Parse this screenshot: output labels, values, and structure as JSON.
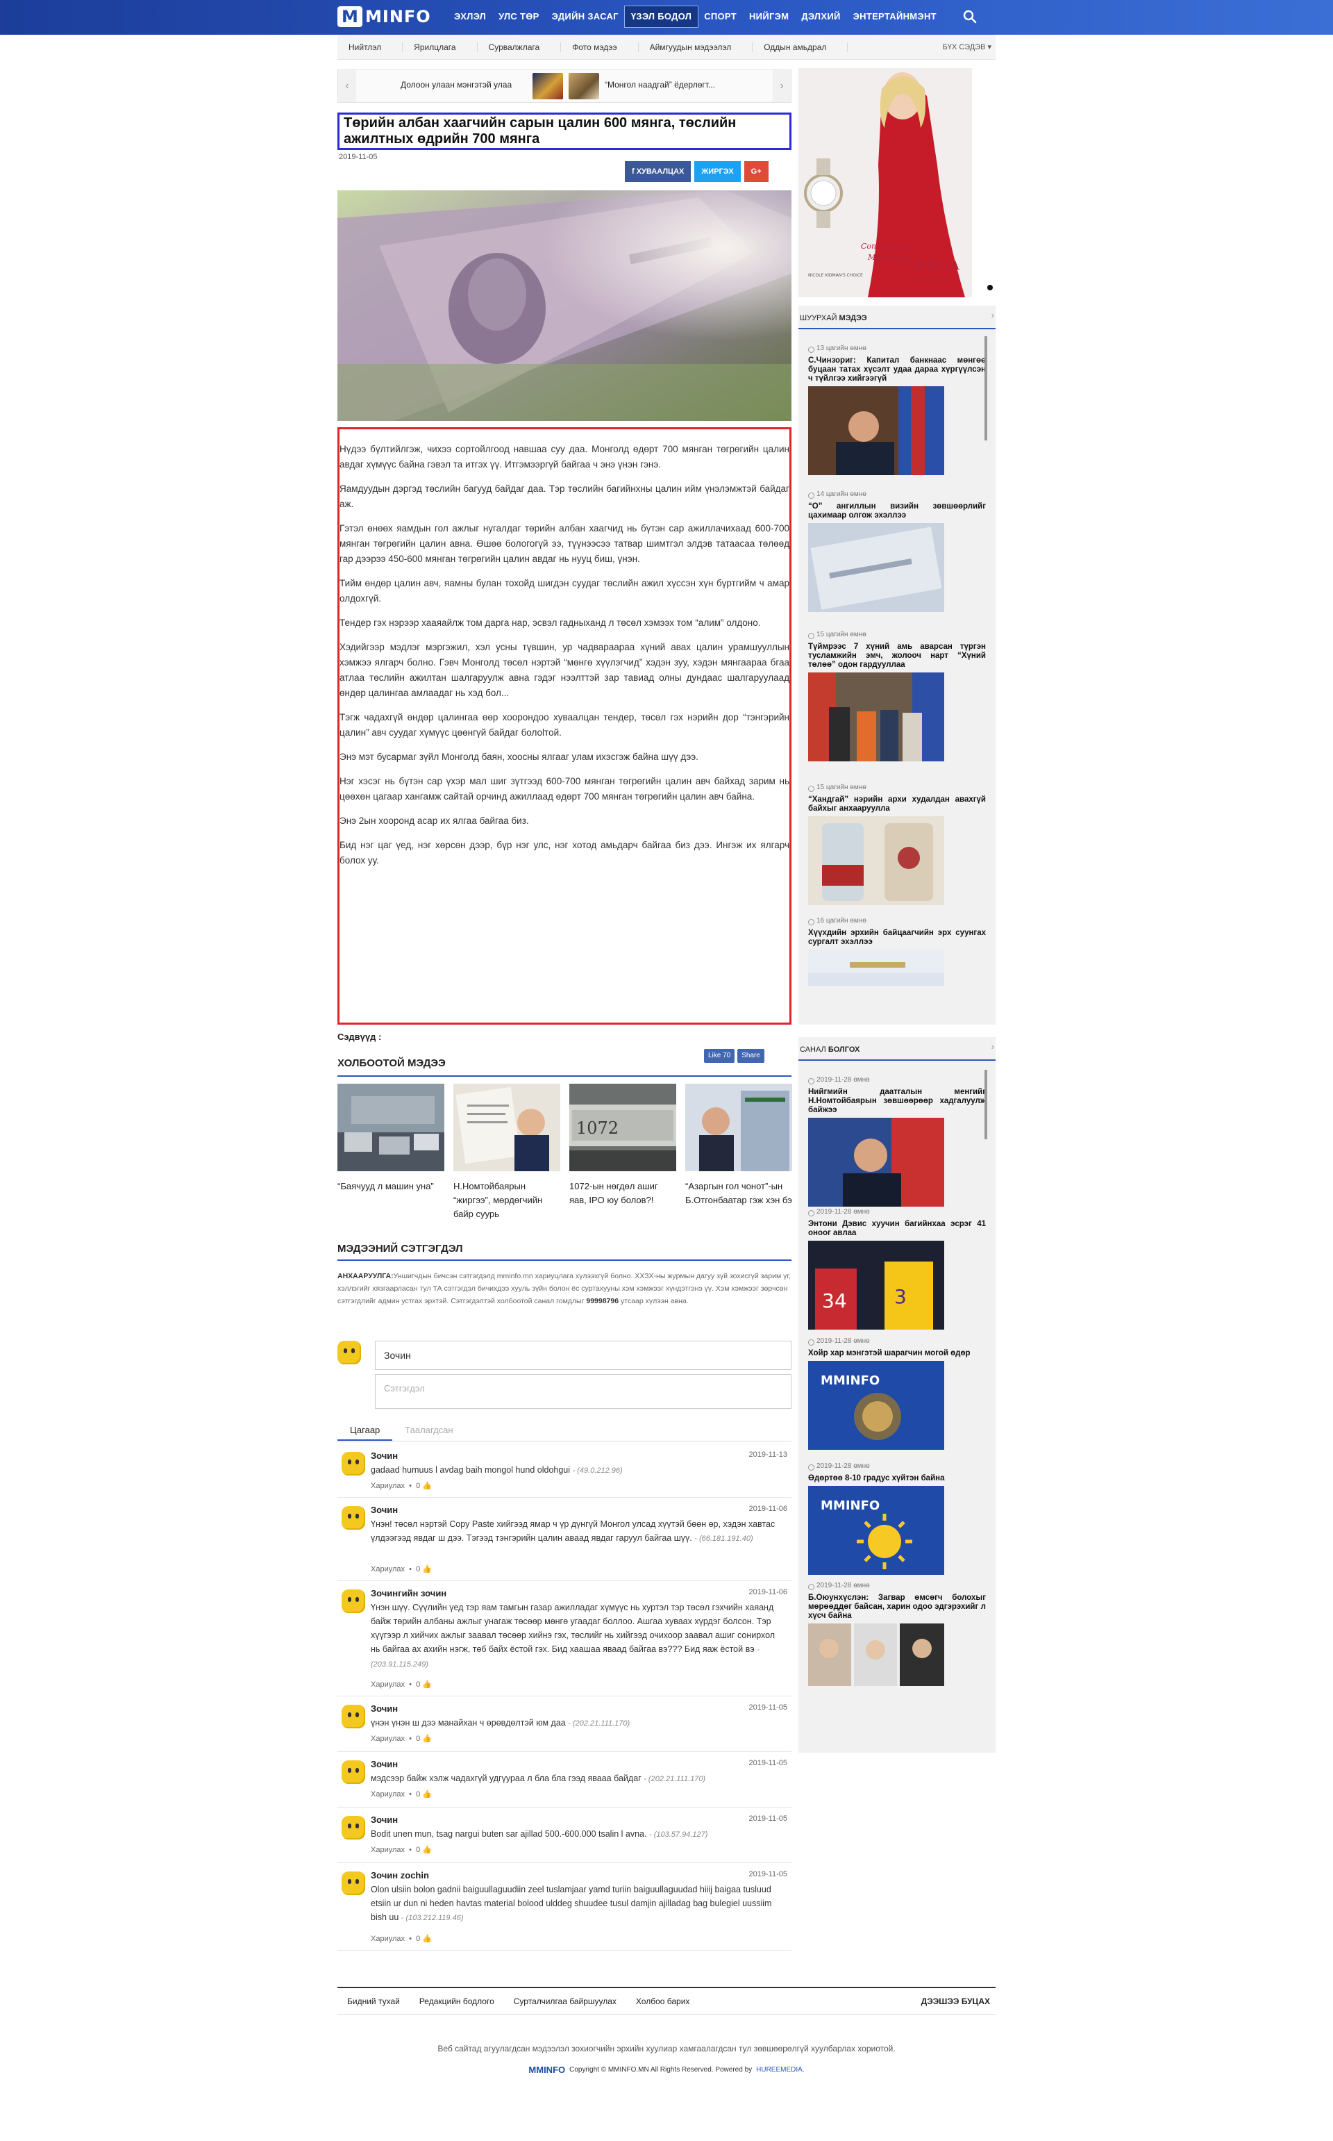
{
  "site": {
    "logo_mark": "M",
    "logo_text": "MINFO"
  },
  "nav": [
    {
      "label": "ЭХЛЭЛ"
    },
    {
      "label": "УЛС ТӨР"
    },
    {
      "label": "ЭДИЙН ЗАСАГ"
    },
    {
      "label": "ҮЗЭЛ БОДОЛ"
    },
    {
      "label": "СПОРТ"
    },
    {
      "label": "НИЙГЭМ"
    },
    {
      "label": "ДЭЛХИЙ"
    },
    {
      "label": "ЭНТЕРТАЙНМЭНТ"
    }
  ],
  "subnav": [
    {
      "label": "Нийтлэл"
    },
    {
      "label": "Ярилцлага"
    },
    {
      "label": "Сурвалжлага"
    },
    {
      "label": "Фото мэдээ"
    },
    {
      "label": "Аймгуудын мэдээлэл"
    },
    {
      "label": "Оддын амьдрал"
    }
  ],
  "subnav_all": "БҮХ СЭДЭВ ▾",
  "ticker": {
    "prev": "‹",
    "next": "›",
    "item1": "Долоон улаан мэнгэтэй улаан...",
    "item2": "“Монгол наадгай” ёдерлөгт..."
  },
  "article": {
    "title": "Төрийн албан хаагчийн сарын цалин 600 мянга, төслийн ажилтных өдрийн 700 мянга",
    "date": "2019-11-05",
    "paragraphs": [
      "Нүдээ бүлтийлгэж, чихээ сортойлгоод навшаа суу даа. Монголд өдөрт 700 мянган төгрөгийн цалин авдаг хүмүүс байна гэвэл та итгэх үү. Итгэмээргүй байгаа ч энэ үнэн гэнэ.",
      "Яамдуудын дэргэд төслийн багууд байдаг даа. Тэр төслийн багийнхны цалин ийм үнэлэмжтэй байдаг аж.",
      "Гэтэл өнөөх яамдын гол ажлыг нугалдаг төрийн албан хаагчид нь бүтэн сар ажиллачихаад 600-700 мянган төгрөгийн цалин авна. Өшөө бологогүй ээ, түүнээсээ татвар шимтгэл элдэв татаасаа төлөөд гар дээрээ 450-600 мянган төгрөгийн цалин авдаг нь нууц биш, үнэн.",
      "Тийм өндөр цалин авч, яамны булан тохойд шигдэн суудаг төслийн ажил хүссэн хүн бүртгийм ч амар олдохгүй.",
      "Тендер гэх нэрээр хааяайлж том дарга нар, эсвэл гадныханд л төсөл хэмээх том “алим” олдоно.",
      "Хэдийгээр мэдлэг мэргэжил, хэл усны түвшин, ур чадвараараа хүний авах цалин урамшууллын хэмжээ ялгарч болно. Гэвч Монголд төсөл нэртэй “мөнгө хүүлэгчид” хэдэн зуу, хэдэн мянгаараа бгаа атлаа төслийн ажилтан шалгаруулж авна гэдэг нээлттэй зар тавиад олны дундаас шалгаруулаад өндөр цалингаа амлаадаг нь хэд бол...",
      "Тэгж чадахгүй өндөр цалингаа өөр хоорондоо хуваалцан тендер, төсөл гэх нэрийн дор “тэнгэрийн цалин” авч суудаг хүмүүс цөөнгүй байдаг болоlтой.",
      "Энэ мэт бусармаг зүйл Монголд баян, хоосны ялгааг улам ихэсгэж байна шүү дээ.",
      "Нэг хэсэг нь бүтэн сар үхэр мал шиг зүтгээд 600-700 мянган төгрөгийн цалин авч байхад зарим нь цөөхөн цагаар хангамж сайтай орчинд ажиллаад өдөрт 700 мянган төгрөгийн цалин авч байна.",
      "Энэ 2ын хооронд асар их ялгаа байгаа биз.",
      "Бид нэг цаг үед, нэг хөрсөн дээр, бүр нэг улс, нэг хотод амьдарч байгаа биз дээ. Ингэж их ялгарч болох уу."
    ],
    "tags_label": "Сэдвүүд :"
  },
  "share": {
    "facebook": "f  ХУВААЛЦАХ",
    "twitter": "ЖИРГЭХ",
    "google": "G+"
  },
  "related": {
    "title": "ХОЛБООТОЙ МЭДЭЭ",
    "like": "Like 70",
    "share_btn": "Share",
    "items": [
      {
        "caption": "“Баячууд л машин уна”"
      },
      {
        "caption": "Н.Номтойбаярын “жиргээ”, мөрдөгчийн байр суурь"
      },
      {
        "caption": "1072-ын нөгдөл ашиг яав, IPO юу болов?!"
      },
      {
        "caption": "“Азаргын гол чонот”-ын Б.Отгонбаатар гэж хэн бэ"
      }
    ]
  },
  "comments_section": {
    "title": "МЭДЭЭНИЙ СЭТГЭГДЭЛ",
    "notice_label": "АНХААРУУЛГА:",
    "notice": "Уншигчдын бичсэн сэтгэгдэлд mminfo.mn хариуцлага хүлээхгүй болно. ХХЗХ-ны журмын дагуу зүй зохисгүй зарим үг, хэллэгийг хязгаарласан тул ТА сэтгэгдэл бичихдээ хууль зүйн болон ёс суртахууны хэм хэмжээг хүндэтгэнэ үү. Хэм хэмжээг зөрчсөн сэтгэгдлийг админ устгах эрхтэй. Сэтгэгдэлтэй холбоотой санал гомдлыг",
    "notice_phone": "99998796",
    "notice_tail": "утсаар хүлээн авна.",
    "name_value": "Зочин",
    "body_placeholder": "Сэтгэгдэл",
    "tab_time": "Цагаар",
    "tab_popular": "Таалагдсан",
    "reply_label": "Хариулах",
    "items": [
      {
        "author": "Зочин",
        "date": "2019-11-13",
        "text": "gadaad humuus l avdag baih mongol hund oldohgui",
        "ip": "- (49.0.212.96)",
        "likes": "0"
      },
      {
        "author": "Зочин",
        "date": "2019-11-06",
        "text": "Үнэн! төсөл нэртэй Copy Paste хийгээд ямар ч үр дүнгүй Монгол улсад хүүтэй бөөн өр, хэдэн хавтас үлдээгээд явдаг ш дээ. Тэгээд тэнгэрийн цалин аваад явдаг гаруул байгаа шүү.",
        "ip": "- (66.181.191.40)",
        "likes": "0"
      },
      {
        "author": "Зочингийн зочин",
        "date": "2019-11-06",
        "text": "Үнэн шүү. Сүүлийн үед тэр яам тамгын газар ажилладаг хүмүүс нь хуртэл тэр төсөл гэхчийн хаяанд байж төрийн албаны ажлыг унагаж төсөөр мөнгө угаадаг боллоо. Ашгаа хуваах хүрдэг болсон. Тэр хүүгээр л хийчих ажлыг заавал төсөөр хийнэ гэх, төслийг нь хийгээд очихоор заавал ашиг сонирхол нь байгаа ах ахийн нэгж, төб байх ёстой гэх. Бид хаашаа яваад байгаа вэ??? Бид яаж ёстой вэ",
        "ip": "- (203.91.115.249)",
        "likes": "0"
      },
      {
        "author": "Зочин",
        "date": "2019-11-05",
        "text": "үнэн үнэн ш дээ манайхан ч өрөвдөлтэй юм даа",
        "ip": "- (202.21.111.170)",
        "likes": "0"
      },
      {
        "author": "Зочин",
        "date": "2019-11-05",
        "text": "мэдсээр байж хэлж чадахгүй удгүураа л бла бла гээд явааа байдаг",
        "ip": "- (202.21.111.170)",
        "likes": "0"
      },
      {
        "author": "Зочин",
        "date": "2019-11-05",
        "text": "Bodit unen mun, tsag nargui buten sar ajillad 500.-600.000 tsalin l avna.",
        "ip": "- (103.57.94.127)",
        "likes": "0"
      },
      {
        "author": "Зочин zochin",
        "date": "2019-11-05",
        "text": "Olon ulsiin bolon gadnii baiguullaguudiin zeel tuslamjaar yamd turiin baiguullaguudad hiiij baigaa tusluud etsiin ur dun ni heden havtas material bolood ulddeg shuudee tusul damjin ajilladag bag bulegiel uussiim bish uu",
        "ip": "- (103.212.119.46)",
        "likes": "0"
      }
    ]
  },
  "sidebar": {
    "breaking_title_a": "ШУУРХАЙ ",
    "breaking_title_b": "МЭДЭЭ",
    "more": "›",
    "breaking": [
      {
        "time": "13 цагийн өмнө",
        "title": "С.Чинзориг: Капитал банкнаас мөнгөө буцаан татах хүсэлт удаа дараа хүргүүлсэн ч түйлгээ хийгээгүй"
      },
      {
        "time": "14 цагийн өмнө",
        "title": "“О” ангиллын визийн зөвшөөрлийг цахимаар олгож эхэллээ"
      },
      {
        "time": "15 цагийн өмнө",
        "title": "Түймрээс 7 хүний амь аварсан түргэн тусламжийн эмч, жолооч нарт “Хүний төлөө” одон гардууллаа"
      },
      {
        "time": "15 цагийн өмнө",
        "title": "“Хандгай” нэрийн архи худалдан авахгүй байхыг анхааруулла"
      },
      {
        "time": "16 цагийн өмнө",
        "title": "Хүүхдийн эрхийн байцаагчийн эрх суунгах сургалт эхэллээ"
      }
    ],
    "poll_title_a": "САНАЛ ",
    "poll_title_b": "БОЛГОХ",
    "opinion": [
      {
        "time": "2019-11-28 өмнө",
        "title": "Нийгмийн даатгалын менгийг Н.Номтойбаярын зөвшөөрөөр хадгалуулж байжээ"
      },
      {
        "time": "2019-11-28 өмнө",
        "title": "Энтони Дэвис хуучин багийнхаа эсрэг 41 оноог авлаа"
      },
      {
        "time": "2019-11-28 өмнө",
        "title": "Хойр хар мэнгэтэй шарагчин могой өдөр"
      },
      {
        "time": "2019-11-28 өмнө",
        "title": "Өдөртөө 8-10 градус хүйтэн байна"
      },
      {
        "time": "2019-11-28 өмнө",
        "title": "Б.Оюунхүслэн: Загвар өмсөгч болохыг мөрөөддөг байсан, харин одоо эдгэрэхийг л хүсч байна"
      }
    ],
    "ad_text1": "Constellation",
    "ad_text2": "Manhattan",
    "ad_brand": "OMEGA",
    "ad_cta": "DISCOVER MORE ›",
    "ad_caption": "NICOLE KIDMAN'S CHOICE"
  },
  "footer": {
    "links": [
      {
        "label": "Бидний тухай"
      },
      {
        "label": "Редакцийн бодлого"
      },
      {
        "label": "Сурталчилгаа байршуулах"
      },
      {
        "label": "Холбоо барих"
      }
    ],
    "back_to_top": "ДЭЭШЭЭ БУЦАХ",
    "note": "Веб сайтад агуулагдсан мэдээлэл зохиогчийн эрхийн хуулиар хамгаалагдсан тул зөвшөөрөлгүй хуулбарлах хориотой.",
    "mini_logo": "MMINFO",
    "copyright": "Copyright © MMINFO.MN All Rights Reserved. Powered by",
    "powered": "HUREEMEDIA."
  },
  "colors": {
    "brand": "#2a57c2",
    "facebook": "#3b5998",
    "twitter": "#1da1f2",
    "google": "#dd4b39"
  }
}
